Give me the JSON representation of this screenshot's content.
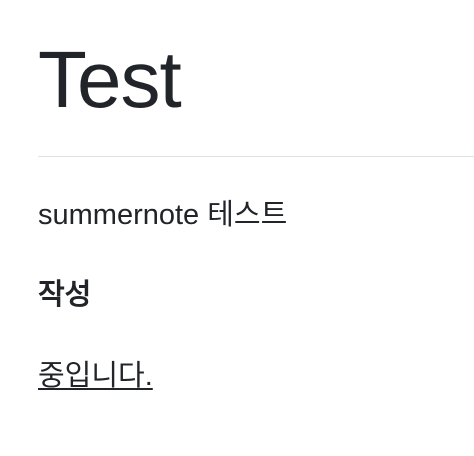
{
  "document": {
    "title": "Test",
    "paragraphs": [
      "summernote 테스트",
      "작성",
      "중입니다."
    ]
  },
  "colors": {
    "text": "#212529",
    "divider": "#dee2e6",
    "background": "#ffffff"
  }
}
